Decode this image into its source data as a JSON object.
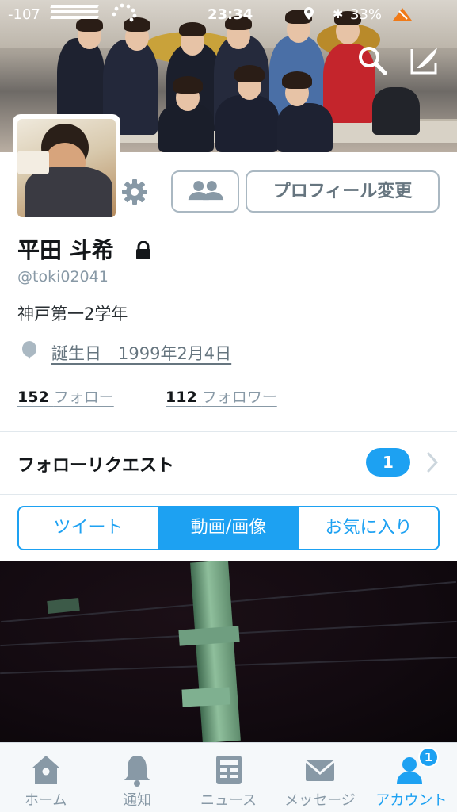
{
  "status_bar": {
    "signal": "-107",
    "time": "23:34",
    "bluetooth": "✱",
    "battery": "33%"
  },
  "profile": {
    "name": "平田 斗希",
    "handle": "@toki02041",
    "bio": "神戸第一2学年",
    "birthday": "誕生日　1999年2月4日",
    "following_count": "152",
    "following_label": "フォロー",
    "followers_count": "112",
    "followers_label": "フォロワー",
    "edit_profile_label": "プロフィール変更"
  },
  "follow_requests": {
    "label": "フォローリクエスト",
    "count": "1"
  },
  "tabs": [
    {
      "label": "ツイート",
      "active": false
    },
    {
      "label": "動画/画像",
      "active": true
    },
    {
      "label": "お気に入り",
      "active": false
    }
  ],
  "nav": {
    "items": [
      {
        "label": "ホーム",
        "icon": "home-icon"
      },
      {
        "label": "通知",
        "icon": "bell-icon"
      },
      {
        "label": "ニュース",
        "icon": "news-icon"
      },
      {
        "label": "メッセージ",
        "icon": "envelope-icon"
      },
      {
        "label": "アカウント",
        "icon": "account-icon",
        "active": true
      }
    ],
    "account_badge": "1"
  },
  "colors": {
    "accent": "#1da1f2",
    "text_primary": "#14171a",
    "text_secondary": "#8899a6",
    "border": "#aab8c2"
  }
}
